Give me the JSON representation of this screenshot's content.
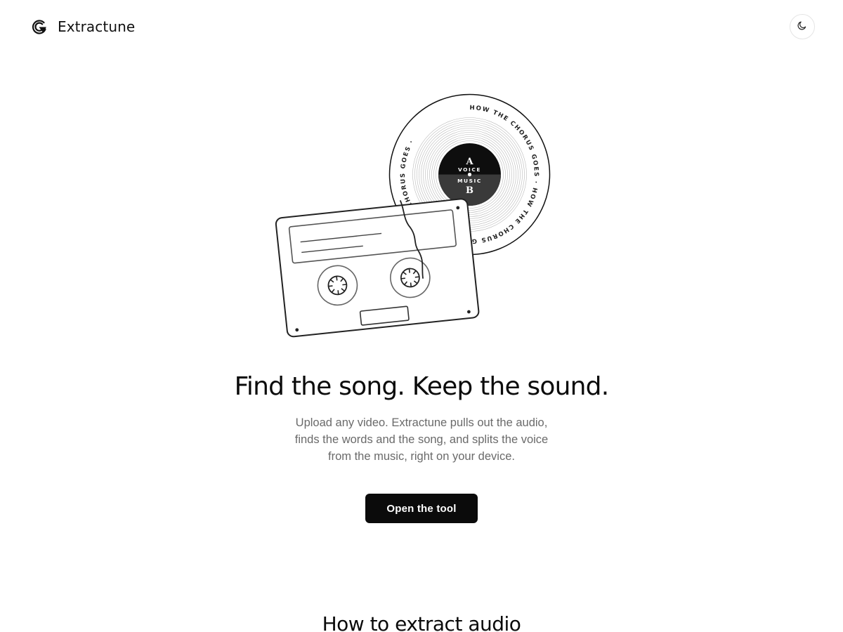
{
  "header": {
    "brand": "Extractune",
    "logo_icon": "extractune-logo-icon",
    "theme_toggle_icon": "moon-icon"
  },
  "illustration": {
    "record_ring_text": "HOW THE CHORUS GOES · HOW THE CHORUS GOES · HOW THE CHORUS GOES · ",
    "side_a_letter": "A",
    "side_a_label": "VOICE",
    "side_b_label": "MUSIC",
    "side_b_letter": "B"
  },
  "hero": {
    "title": "Find the song. Keep the sound.",
    "subtitle": "Upload any video. Extractune pulls out the audio, finds the words and the song, and splits the voice from the music, right on your device.",
    "cta_label": "Open the tool"
  },
  "next_section": {
    "title": "How to extract audio"
  },
  "colors": {
    "text_primary": "#0b0b0b",
    "text_secondary": "#6a6a6a",
    "button_bg": "#0b0b0b",
    "button_text": "#ffffff",
    "border": "#e4e4e4"
  }
}
